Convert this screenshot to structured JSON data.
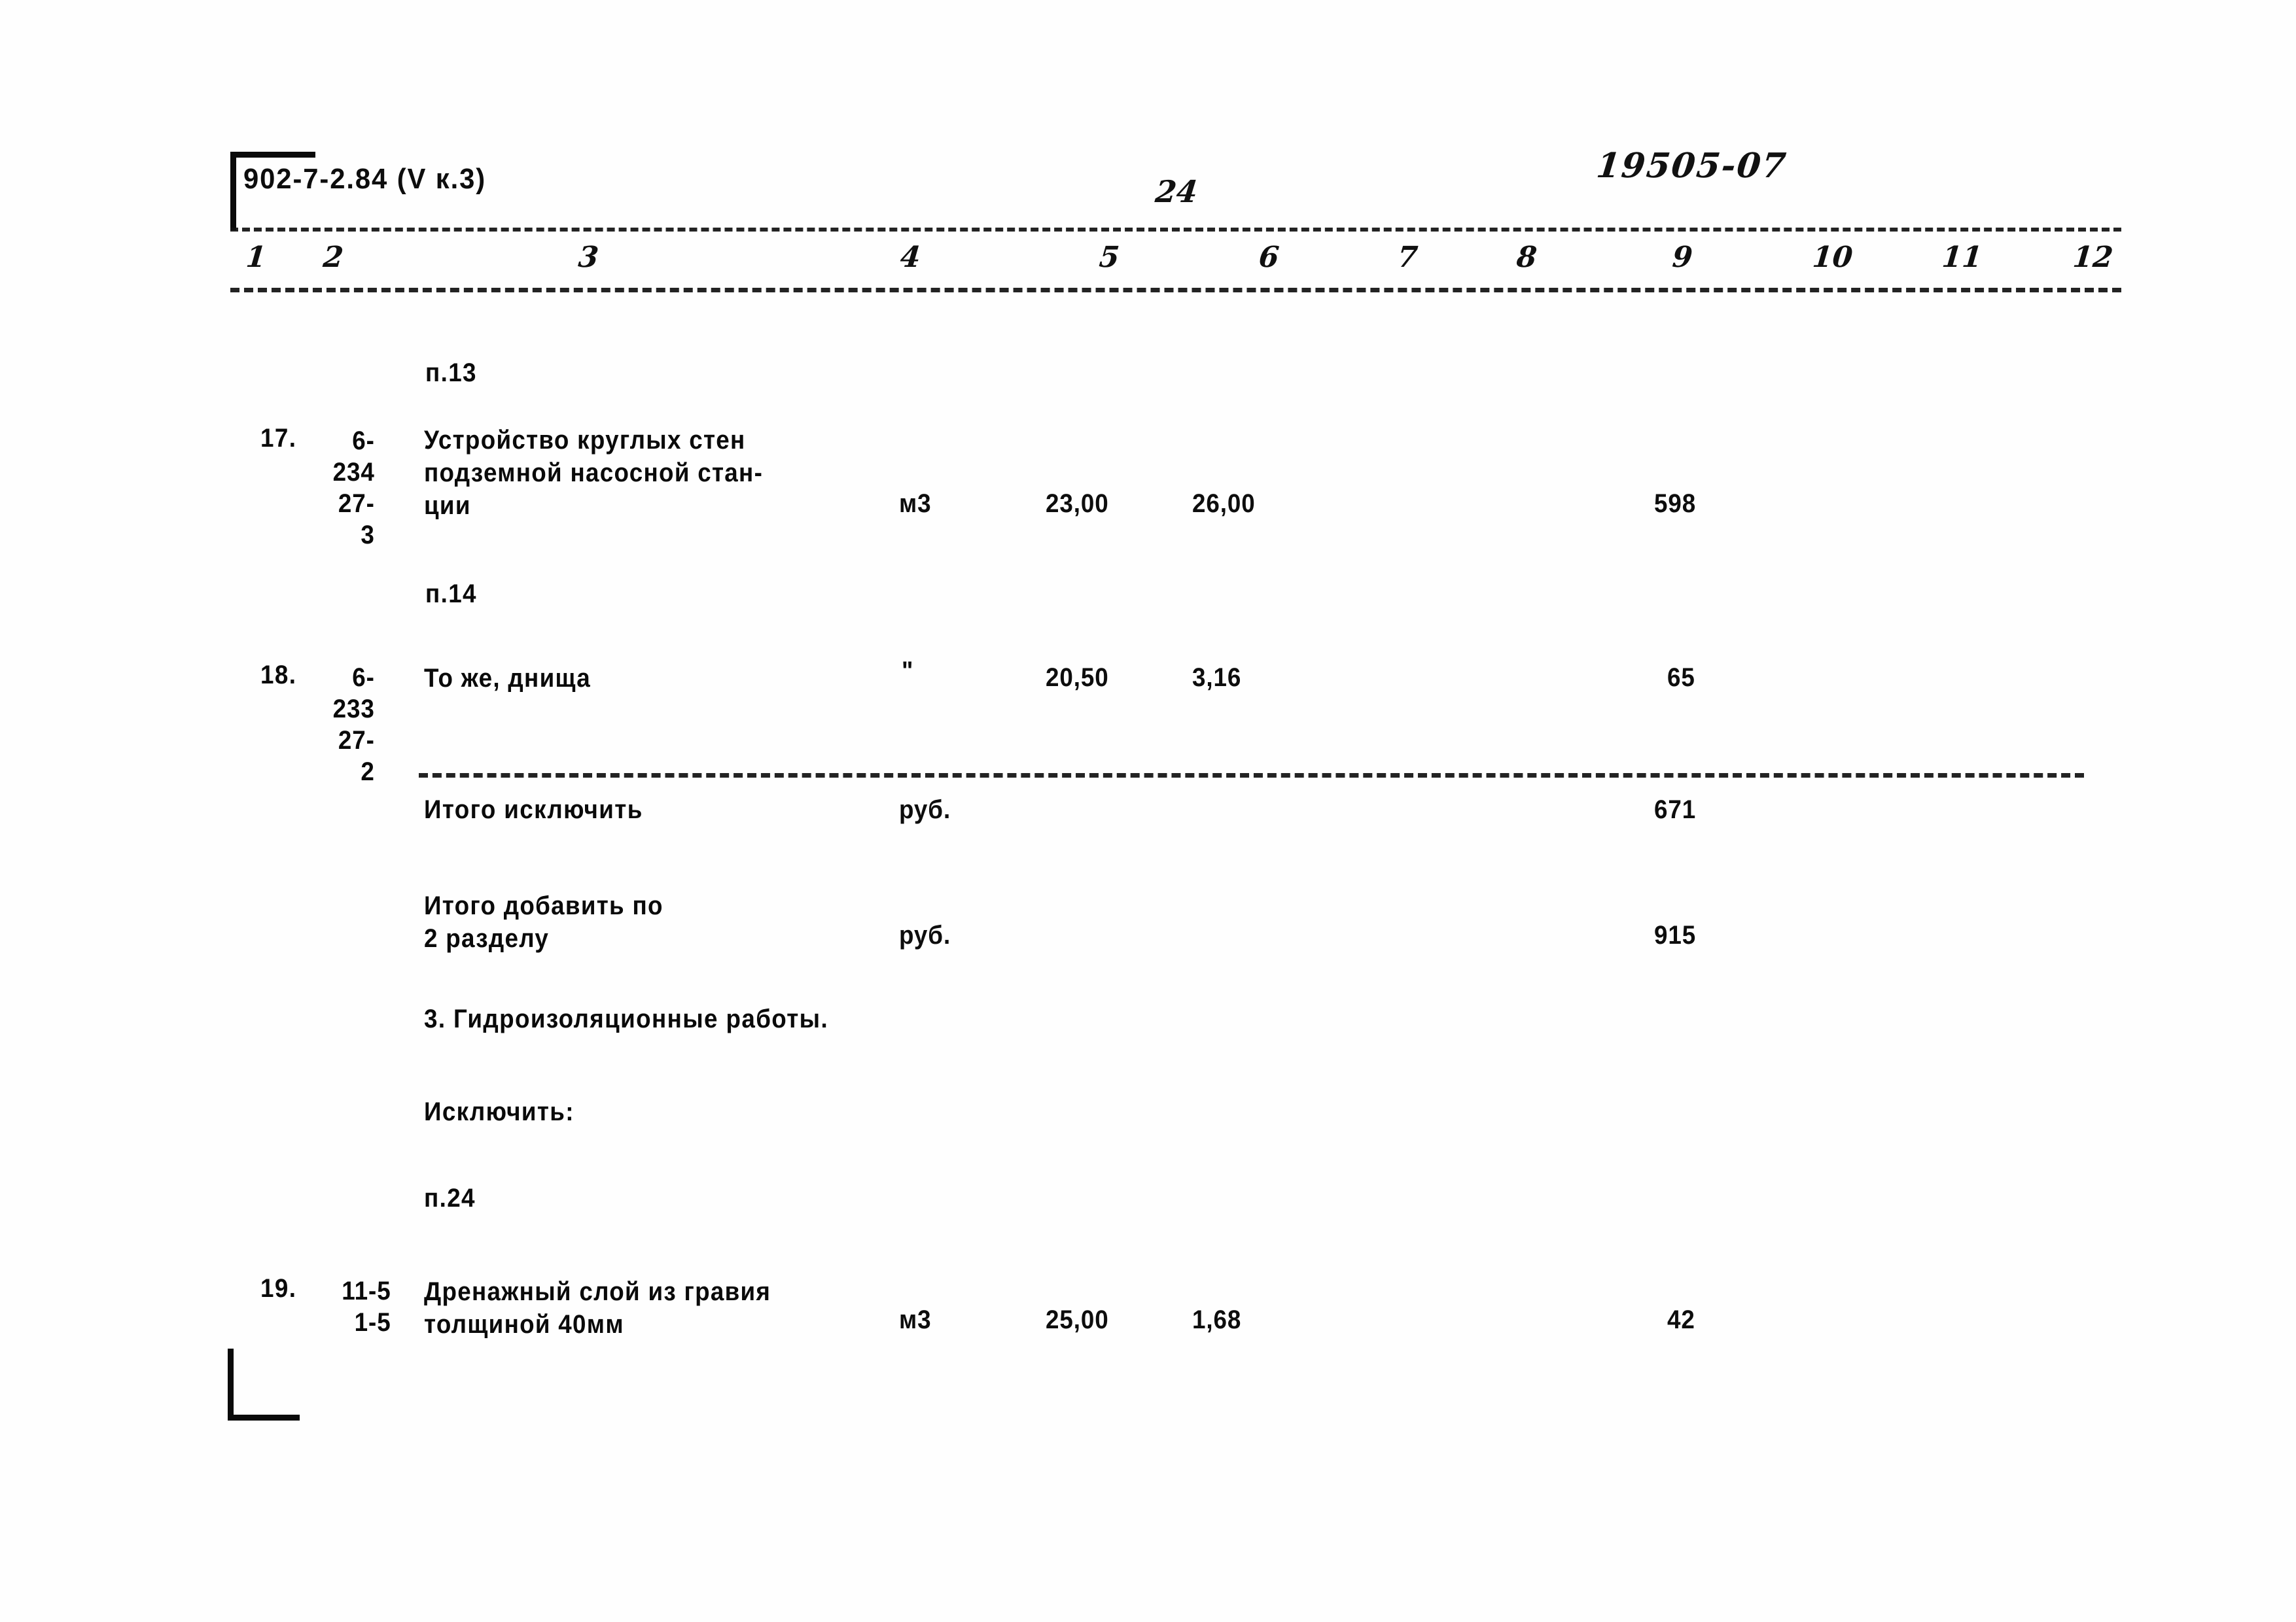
{
  "document": {
    "series_code": "902-7-2.84 (V к.3)",
    "page_number": "24",
    "archive_code": "19505-07"
  },
  "table": {
    "column_numbers": [
      "1",
      "2",
      "3",
      "4",
      "5",
      "6",
      "7",
      "8",
      "9",
      "10",
      "11",
      "12"
    ],
    "rows": [
      {
        "ref_label": "п.13",
        "item_no": "17.",
        "code": "6-\n234\n27-\n3",
        "description": "Устройство круглых стен\nподземной насосной стан-\nции",
        "unit": "м3",
        "col5": "23,00",
        "col6": "26,00",
        "col9": "598"
      },
      {
        "ref_label": "п.14",
        "item_no": "18.",
        "code": "6-\n233\n27-\n2",
        "description": "То же, днища",
        "unit": "\"",
        "col5": "20,50",
        "col6": "3,16",
        "col9": "65"
      }
    ],
    "totals": [
      {
        "label": "Итого исключить",
        "unit": "руб.",
        "value": "671"
      },
      {
        "label": "Итого добавить по\n2 разделу",
        "unit": "руб.",
        "value": "915"
      }
    ],
    "section": {
      "heading": "3. Гидроизоляционные работы.",
      "action": "Исключить:"
    },
    "last_row": {
      "ref_label": "п.24",
      "item_no": "19.",
      "code": "11-5\n1-5",
      "description": "Дренажный слой из гравия\nтолщиной 40мм",
      "unit": "м3",
      "col5": "25,00",
      "col6": "1,68",
      "col9": "42"
    }
  }
}
